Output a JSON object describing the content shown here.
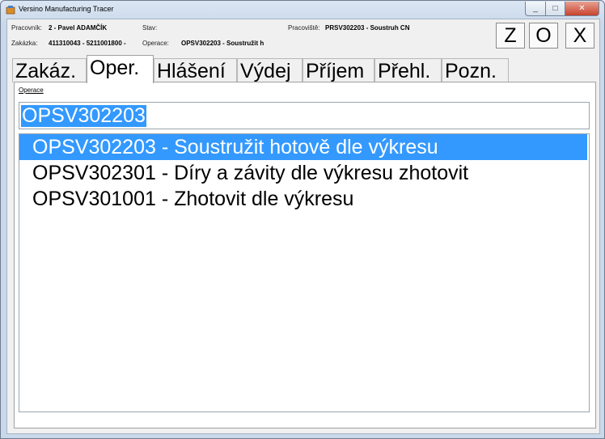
{
  "window": {
    "title": "Versino Manufacturing Tracer",
    "minimize_glyph": "_",
    "maximize_glyph": "□",
    "close_glyph": "✕"
  },
  "header": {
    "worker_label": "Pracovník:",
    "worker_value": "2 - Pavel ADAMČÍK",
    "state_label": "Stav:",
    "state_value": "",
    "workplace_label": "Pracoviště:",
    "workplace_value": "PRSV302203 - Soustruh CN",
    "order_label": "Zakázka:",
    "order_value": "411310043 - 5211001800 -",
    "operation_label": "Operace:",
    "operation_value": "OPSV302203 - Soustružit h"
  },
  "actions": {
    "z_label": "Z",
    "o_label": "O",
    "x_label": "X"
  },
  "tabs": [
    {
      "label": "Zakáz."
    },
    {
      "label": "Oper."
    },
    {
      "label": "Hlášení"
    },
    {
      "label": "Výdej"
    },
    {
      "label": "Příjem"
    },
    {
      "label": "Přehl."
    },
    {
      "label": "Pozn."
    }
  ],
  "active_tab": "Oper.",
  "operation_panel": {
    "field_label": "Operace",
    "input_value": "OPSV302203",
    "list": [
      {
        "text": "OPSV302203 - Soustružit hotově dle výkresu",
        "selected": true
      },
      {
        "text": "OPSV302301 - Díry a závity dle výkresu zhotovit",
        "selected": false
      },
      {
        "text": "OPSV301001 - Zhotovit dle výkresu",
        "selected": false
      }
    ]
  },
  "colors": {
    "selection": "#3399ff",
    "panel_background": "#ffffff",
    "client_background": "#f0f0f0"
  }
}
